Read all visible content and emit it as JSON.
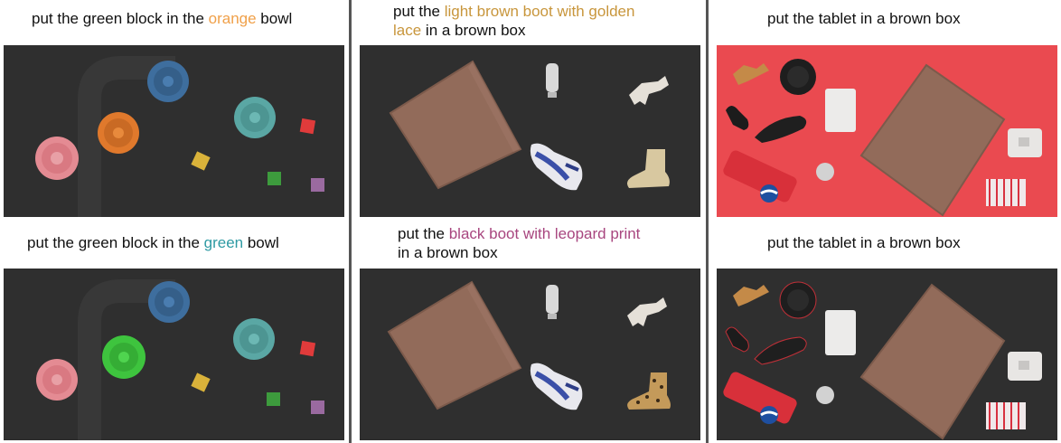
{
  "colors": {
    "orange_text": "#f0a049",
    "teal_text": "#2e9aa3",
    "gold_text": "#c8963c",
    "purple_text": "#a8467f",
    "dark_floor": "#2e2e2e",
    "red_floor": "#ea4a50",
    "box_brown": "#926b5a"
  },
  "columns": [
    {
      "top_caption": {
        "pre": "put the green block in the ",
        "highlight": "orange",
        "post": " bowl"
      },
      "bottom_caption": {
        "pre": "put the green block in the ",
        "highlight": "green",
        "post": " bowl"
      }
    },
    {
      "top_caption": {
        "pre": "put the ",
        "highlight_line1": "light brown boot with golden",
        "highlight_line2": "lace",
        "post": " in a brown box"
      },
      "bottom_caption": {
        "pre": "put the ",
        "highlight": "black boot with leopard print",
        "post": "in a brown box"
      }
    },
    {
      "top_caption": {
        "text": "put the tablet in a brown box"
      },
      "bottom_caption": {
        "text": "put the tablet in a brown box"
      }
    }
  ],
  "icons": [
    "bowl",
    "block",
    "brown-box",
    "bottle",
    "toy-dog",
    "sneaker",
    "boot",
    "dinosaur-toy",
    "pan",
    "shoe",
    "tablet",
    "pepsi-can",
    "clock",
    "router",
    "towel"
  ]
}
